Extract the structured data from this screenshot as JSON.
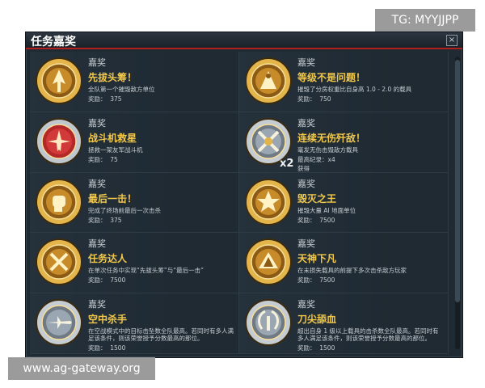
{
  "window": {
    "title": "任务嘉奖",
    "close_label": "×"
  },
  "watermarks": {
    "top": "TG: MYYJJPP",
    "bottom": "www.ag-gateway.org"
  },
  "awards": [
    {
      "category": "嘉奖",
      "name": "先拔头筹！",
      "desc": "全队第一个摧毁敌方单位",
      "reward": "奖励：  375",
      "icon": "first-blood-medal-icon",
      "tone": "gold"
    },
    {
      "category": "嘉奖",
      "name": "等级不是问题！",
      "desc": "摧毁了分房权重比自身高 1.0 - 2.0 的载具",
      "reward": "奖励：  750",
      "icon": "rank-upset-medal-icon",
      "tone": "gold"
    },
    {
      "category": "嘉奖",
      "name": "战斗机救星",
      "desc": "拯救一架友军战斗机",
      "reward": "奖励：  75",
      "icon": "fighter-rescuer-badge-icon",
      "tone": "red"
    },
    {
      "category": "嘉奖",
      "name": "连续无伤歼敌！",
      "desc": "毫发无伤击毁敌方载具",
      "reward": "最高纪录：x4\n获得\n奖励：  300",
      "icon": "crossed-swords-medal-icon",
      "tone": "silver",
      "multiplier": "x2"
    },
    {
      "category": "嘉奖",
      "name": "最后一击！",
      "desc": "完成了终场前最后一次击杀",
      "reward": "奖励：  375",
      "icon": "fist-medal-icon",
      "tone": "gold"
    },
    {
      "category": "嘉奖",
      "name": "毁灭之王",
      "desc": "摧毁大量 AI 地面单位",
      "reward": "奖励：  7500",
      "icon": "destroyer-star-medal-icon",
      "tone": "gold"
    },
    {
      "category": "嘉奖",
      "name": "任务达人",
      "desc": "在单次任务中实现“先拔头筹”与“最后一击”",
      "reward": "奖励：  7500",
      "icon": "tools-star-medal-icon",
      "tone": "gold"
    },
    {
      "category": "嘉奖",
      "name": "天神下凡",
      "desc": "在未损失载具的前提下多次击杀敌方玩家",
      "reward": "奖励：  7500",
      "icon": "wings-star-medal-icon",
      "tone": "gold"
    },
    {
      "category": "嘉奖",
      "name": "空中杀手",
      "desc": "在空战模式中的目标击坠数全队最高。若同时有多人满足该条件，则该荣誉授予分数最高的那位。",
      "reward": "奖励：  1500",
      "icon": "aircraft-medal-icon",
      "tone": "silver"
    },
    {
      "category": "嘉奖",
      "name": "刀尖舔血",
      "desc": "超出自身 1 级以上载具的击杀数全队最高。若同时有多人满足该条件，则该荣誉授予分数最高的那位。",
      "reward": "奖励：  1500",
      "icon": "laurel-medal-icon",
      "tone": "silver"
    }
  ]
}
